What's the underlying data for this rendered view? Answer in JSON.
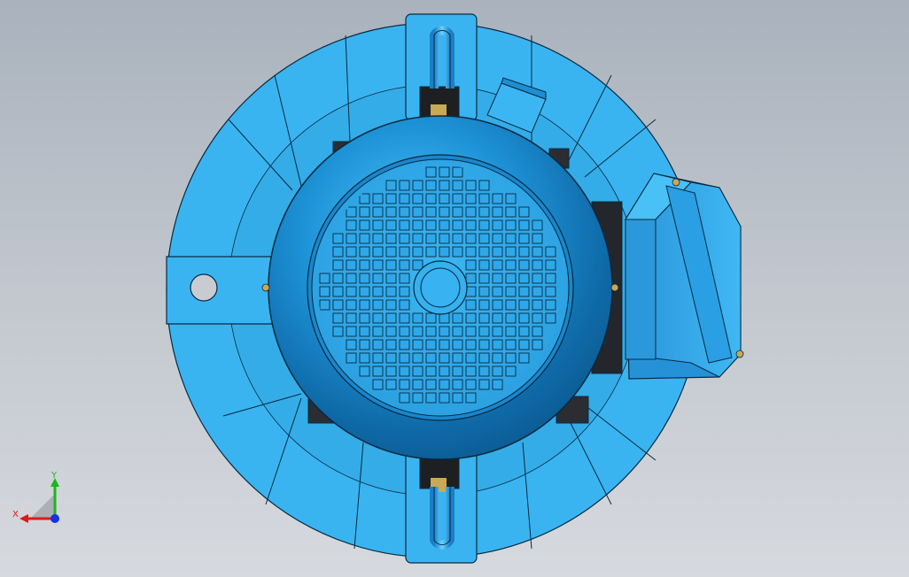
{
  "viewport": {
    "background_top": "#a9b2bd",
    "background_bottom": "#d6d9de",
    "model_color": "#38b0ec",
    "model_color_dark": "#1879b8",
    "edge_color": "#0a2a40"
  },
  "triad": {
    "x_label": "X",
    "y_label": "Y",
    "x_color": "#e01818",
    "y_color": "#18b818",
    "z_color": "#1830e0"
  }
}
